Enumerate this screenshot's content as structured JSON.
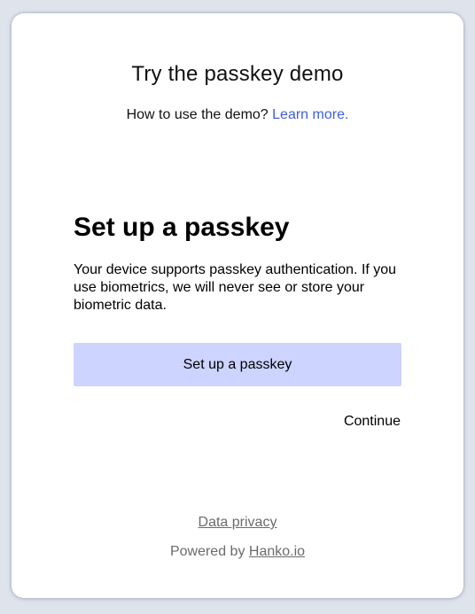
{
  "demo": {
    "title": "Try the passkey demo",
    "help_text": "How to use the demo? ",
    "learn_more_label": "Learn more."
  },
  "setup": {
    "heading": "Set up a passkey",
    "description": "Your device supports passkey authentication. If you use biometrics, we will never see or store your biometric data.",
    "button_label": "Set up a passkey",
    "continue_label": "Continue"
  },
  "footer": {
    "privacy_label": "Data privacy",
    "powered_by_text": "Powered by ",
    "powered_by_link": "Hanko.io"
  },
  "colors": {
    "link": "#3d5ee0",
    "primary_button": "#cdd4ff",
    "footer_text": "#6b6b6b",
    "background": "#dfe3ec"
  }
}
